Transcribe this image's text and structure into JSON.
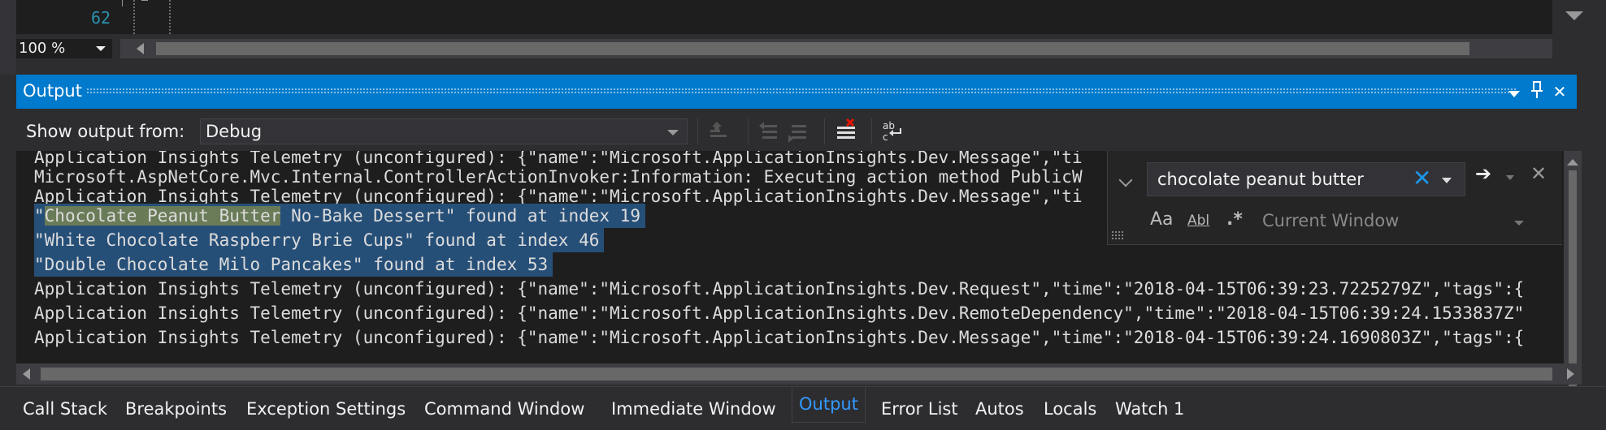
{
  "editor": {
    "line_number": "62",
    "zoom": "100 %"
  },
  "output_window": {
    "title": "Output",
    "show_output_from_label": "Show output from:",
    "source": "Debug",
    "lines": [
      {
        "text": "Application Insights Telemetry (unconfigured): {\"name\":\"Microsoft.ApplicationInsights.Dev.Message\",\"ti"
      },
      {
        "text": "Microsoft.AspNetCore.Mvc.Internal.ControllerActionInvoker:Information: Executing action method PublicW"
      },
      {
        "text": "Application Insights Telemetry (unconfigured): {\"name\":\"Microsoft.ApplicationInsights.Dev.Message\",\"ti"
      },
      {
        "pre": "\"",
        "match": "Chocolate Peanut Butter",
        "post": " No-Bake Dessert\" found at index 19"
      },
      {
        "text": "\"White Chocolate Raspberry Brie Cups\" found at index 46"
      },
      {
        "text": "\"Double Chocolate Milo Pancakes\" found at index 53"
      },
      {
        "text": "Application Insights Telemetry (unconfigured): {\"name\":\"Microsoft.ApplicationInsights.Dev.Request\",\"time\":\"2018-04-15T06:39:23.7225279Z\",\"tags\":{"
      },
      {
        "text": "Application Insights Telemetry (unconfigured): {\"name\":\"Microsoft.ApplicationInsights.Dev.RemoteDependency\",\"time\":\"2018-04-15T06:39:24.1533837Z\""
      },
      {
        "text": "Application Insights Telemetry (unconfigured): {\"name\":\"Microsoft.ApplicationInsights.Dev.Message\",\"time\":\"2018-04-15T06:39:24.1690803Z\",\"tags\":{"
      }
    ]
  },
  "find": {
    "query": "chocolate peanut butter",
    "match_case_label": "Aa",
    "whole_word_label": "Abl",
    "regex_label": ".*",
    "scope": "Current Window"
  },
  "tabs": [
    {
      "label": "Call Stack"
    },
    {
      "label": "Breakpoints"
    },
    {
      "label": "Exception Settings"
    },
    {
      "label": "Command Window"
    },
    {
      "label": "Immediate Window"
    },
    {
      "label": "Output",
      "active": true
    },
    {
      "label": "Error List"
    },
    {
      "label": "Autos"
    },
    {
      "label": "Locals"
    },
    {
      "label": "Watch 1"
    }
  ],
  "colors": {
    "accent": "#007acc",
    "selection": "#264f78",
    "active_tab": "#3399ff",
    "background": "#2d2d30"
  }
}
